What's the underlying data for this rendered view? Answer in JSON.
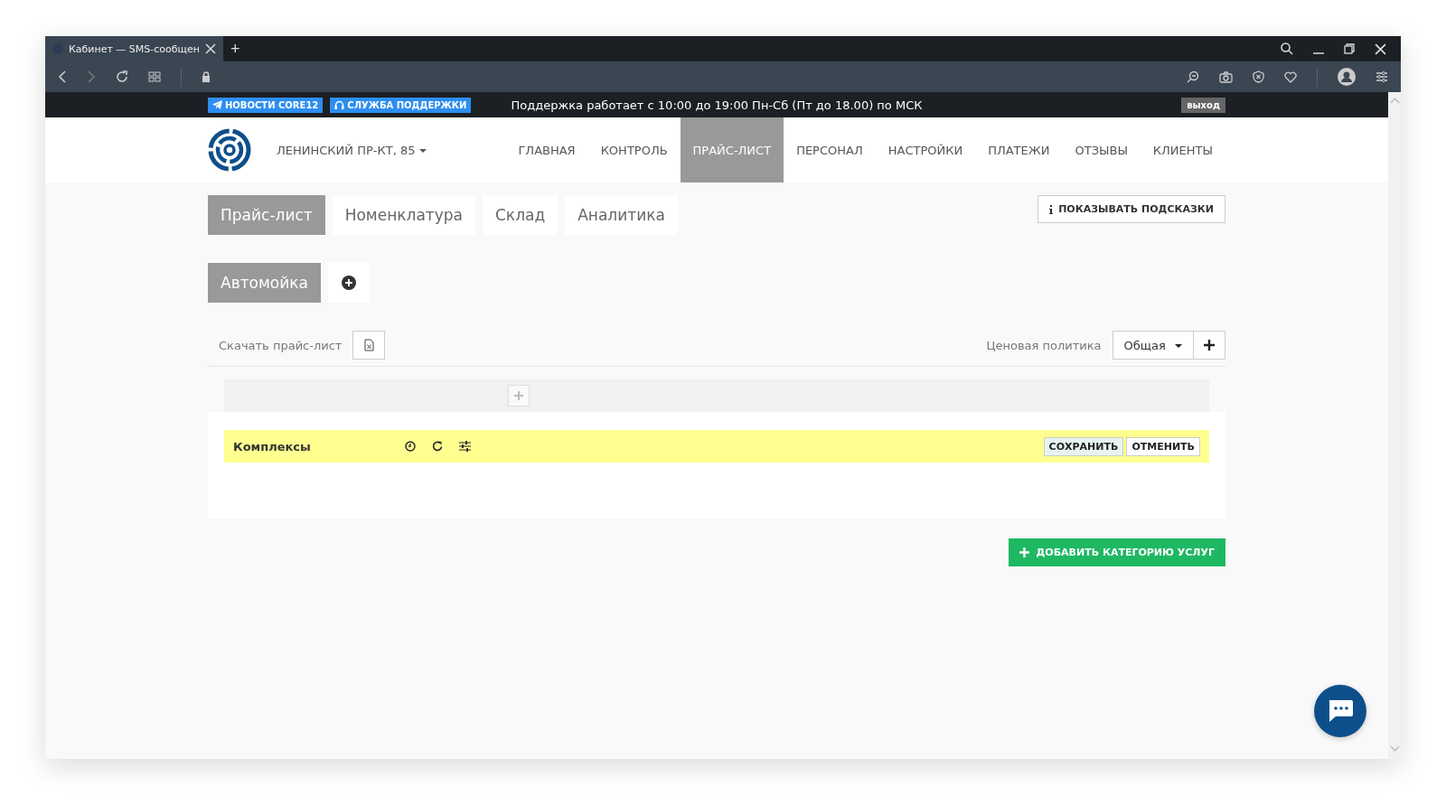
{
  "browser": {
    "tab_title": "Кабинет — SMS-сообщен",
    "new_tab": "+"
  },
  "notice_bar": {
    "links": [
      {
        "label": "НОВОСТИ CORE12",
        "kind": "telegram"
      },
      {
        "label": "СЛУЖБА ПОДДЕРЖКИ",
        "kind": "headset"
      }
    ],
    "message": "Поддержка работает с 10:00 до 19:00 Пн-Сб (Пт до 18.00) по МСК",
    "logout": "выход"
  },
  "header": {
    "location": "ЛЕНИНСКИЙ ПР-КТ, 85",
    "nav": [
      {
        "label": "ГЛАВНАЯ",
        "selected": false
      },
      {
        "label": "КОНТРОЛЬ",
        "selected": false
      },
      {
        "label": "ПРАЙС-ЛИСТ",
        "selected": true
      },
      {
        "label": "ПЕРСОНАЛ",
        "selected": false
      },
      {
        "label": "НАСТРОЙКИ",
        "selected": false
      },
      {
        "label": "ПЛАТЕЖИ",
        "selected": false
      },
      {
        "label": "ОТЗЫВЫ",
        "selected": false
      },
      {
        "label": "КЛИЕНТЫ",
        "selected": false
      }
    ]
  },
  "tabs": [
    {
      "label": "Прайс-лист",
      "selected": true
    },
    {
      "label": "Номенклатура",
      "selected": false
    },
    {
      "label": "Склад",
      "selected": false
    },
    {
      "label": "Аналитика",
      "selected": false
    }
  ],
  "hints_button": "ПОКАЗЫВАТЬ ПОДСКАЗКИ",
  "subtabs": [
    {
      "label": "Автомойка",
      "selected": true
    }
  ],
  "toolbar": {
    "download_label": "Скачать прайс-лист",
    "pricing_label": "Ценовая политика",
    "pricing_value": "Общая"
  },
  "categories": [
    {
      "name": "Комплексы",
      "editing": true,
      "save": "СОХРАНИТЬ",
      "cancel": "ОТМЕНИТЬ"
    }
  ],
  "add_category_button": "ДОБАВИТЬ КАТЕГОРИЮ УСЛУГ"
}
